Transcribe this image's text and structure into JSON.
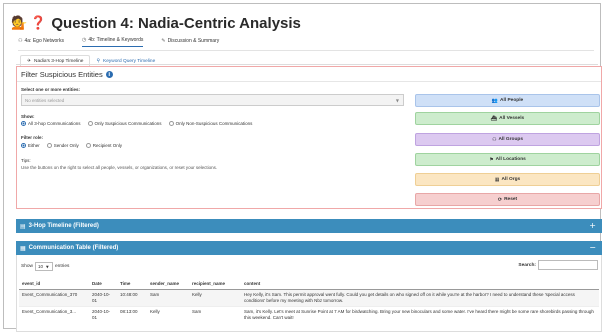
{
  "header": {
    "emoji_1": "💁",
    "emoji_2": "❓",
    "title": "Question 4: Nadia-Centric Analysis"
  },
  "tabs": [
    {
      "icon": "⚇",
      "label": "4a: Ego Networks"
    },
    {
      "icon": "◷",
      "label": "4b: Timeline & Keywords"
    },
    {
      "icon": "✎",
      "label": "Discussion & Summary"
    }
  ],
  "subtabs": [
    {
      "icon": "✈",
      "label": "Nadia's 3-Hop Timeline"
    },
    {
      "icon": "⚲",
      "label": "Keyword Query Timeline"
    }
  ],
  "filter": {
    "title": "Filter Suspicious Entities",
    "info_icon": "i",
    "select_label": "Select one or more entities:",
    "select_placeholder": "No entities selected",
    "show_label": "Show:",
    "show_options": [
      "All 3-hop Communications",
      "Only Suspicious Communications",
      "Only Non-Suspicious Communications"
    ],
    "role_label": "Filter role:",
    "role_options": [
      "Either",
      "Sender Only",
      "Recipient Only"
    ],
    "tips_title": "Tips:",
    "tips_text": "Use the buttons on the right to select all people, vessels, or organizations, or reset your selections."
  },
  "buttons": {
    "people": "All People",
    "vessels": "All Vessels",
    "groups": "All Groups",
    "locations": "All Locations",
    "orgs": "All Orgs",
    "reset": "Reset"
  },
  "colors": {
    "people": "#cfe0f7",
    "vessels": "#cdeccd",
    "groups": "#dcc9f0",
    "locations": "#cdeccd",
    "orgs": "#fbe6c2",
    "reset": "#f6cfcf",
    "panel_header": "#3c8dbc"
  },
  "panels": {
    "timeline_title": "3-Hop Timeline (Filtered)",
    "timeline_toggle": "+",
    "table_title": "Communication Table (Filtered)",
    "table_toggle": "−"
  },
  "datatable": {
    "show_label": "Show",
    "page_length": "10",
    "entries_label": "entries",
    "search_label": "Search:",
    "columns": [
      "event_id",
      "Date",
      "Time",
      "sender_name",
      "recipient_name",
      "content"
    ],
    "rows": [
      {
        "event_id": "Event_Communication_370",
        "date": "2040-10-01",
        "time": "10:48:00",
        "sender": "Sam",
        "recipient": "Kelly",
        "content": "Hey Kelly, it's Sam. This permit approval went fully. Could you get details on who signed off on it while you're at the harbor? I need to understand these 'special access conditions' before my meeting with Nbz tomorrow."
      },
      {
        "event_id": "Event_Communication_3...",
        "date": "2040-10-01",
        "time": "08:13:00",
        "sender": "Kelly",
        "recipient": "Sam",
        "content": "Sam, it's Kelly. Let's meet at Sunrise Point at 7 AM for birdwatching. Bring your new binoculars and some water. I've heard there might be some rare shorebirds passing through this weekend. Can't wait!"
      }
    ]
  }
}
